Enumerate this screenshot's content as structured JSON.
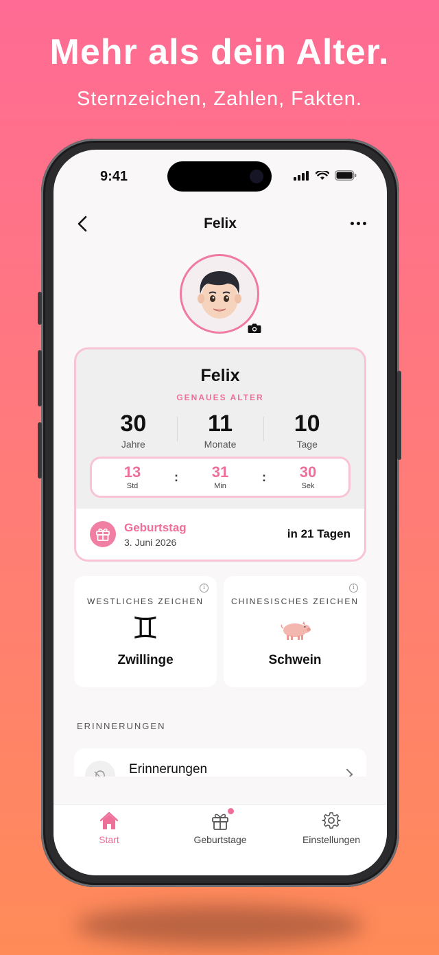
{
  "promo": {
    "headline": "Mehr als dein Alter.",
    "subline": "Sternzeichen, Zahlen, Fakten."
  },
  "status_bar": {
    "time": "9:41",
    "icons": [
      "signal-icon",
      "wifi-icon",
      "battery-icon"
    ]
  },
  "nav": {
    "back_icon": "chevron-left-icon",
    "title": "Felix",
    "more_icon": "ellipsis-icon"
  },
  "profile": {
    "avatar": "boy-memoji-avatar",
    "camera_icon": "camera-icon"
  },
  "age_card": {
    "name": "Felix",
    "subtitle": "GENAUES ALTER",
    "years": {
      "value": "30",
      "label": "Jahre"
    },
    "months": {
      "value": "11",
      "label": "Monate"
    },
    "days": {
      "value": "10",
      "label": "Tage"
    },
    "timer": {
      "hours": {
        "value": "13",
        "label": "Std"
      },
      "minutes": {
        "value": "31",
        "label": "Min"
      },
      "seconds": {
        "value": "30",
        "label": "Sek"
      },
      "separator": ":"
    },
    "birthday": {
      "icon": "gift-icon",
      "title": "Geburtstag",
      "date": "3. Juni 2026",
      "countdown": "in 21 Tagen"
    }
  },
  "signs": {
    "western": {
      "label": "WESTLICHES ZEICHEN",
      "symbol": "♊",
      "name": "Zwillinge"
    },
    "chinese": {
      "label": "CHINESISCHES ZEICHEN",
      "symbol": "🐖",
      "name": "Schwein"
    }
  },
  "reminders": {
    "section_title": "ERINNERUNGEN",
    "item_label": "Erinnerungen",
    "item_icon": "bell-slash-icon"
  },
  "tabbar": {
    "tabs": [
      {
        "label": "Start",
        "icon": "house-icon",
        "active": true
      },
      {
        "label": "Geburtstage",
        "icon": "gift-icon",
        "badge": true
      },
      {
        "label": "Einstellungen",
        "icon": "gear-icon"
      }
    ]
  },
  "colors": {
    "accent": "#ee6f98",
    "accent_light": "#f8c3d5",
    "background_top": "#ff6b94",
    "background_bottom": "#ff8b58"
  }
}
